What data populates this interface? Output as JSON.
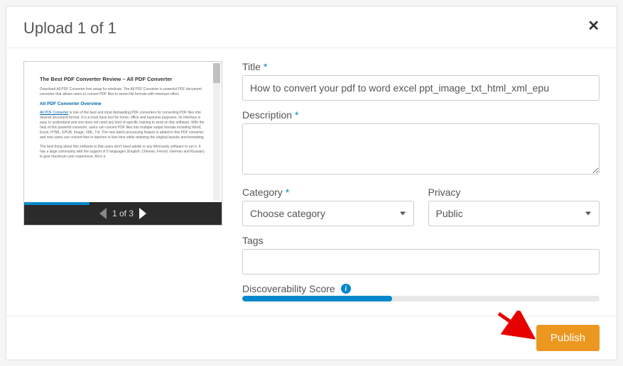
{
  "header": {
    "title": "Upload 1 of 1",
    "close_symbol": "✕"
  },
  "preview": {
    "doc_title": "The Best PDF Converter Review – All PDF Converter",
    "doc_intro": "Download All PDF Converter free setup for windows. The All PDF Converter is powerful PDF document converter that allows users to convert PDF files to seven file formats with minimum effort.",
    "doc_heading2": "All PDF Converter Overview",
    "doc_link": "All PDF Converter",
    "doc_body1": " is one of the best and most demanding PDF converters for converting PDF files into desired document format. It is a must have tool for home, office and business purposes. Its interface is easy to understand and one does not need any kind of specific training to work on this software. With the help of this powerful converter, users can convert PDF files into multiple output formats including Word, Excel, HTML, EPUB, Image, XML, Txt. The new batch processing feature is added in this PDF converter and now users can convert files in batches in less time while retaining the original layouts and formatting.",
    "doc_body2": "The best thing about this software is that users don't need adobe or any third-party software to run it. It has a large community with the support of 5 languages (English, Chinese, French, German and Russian) to give maximum user experience. All in a",
    "page_indicator": "1 of 3",
    "progress_percent": 33
  },
  "form": {
    "title_label": "Title",
    "title_value": "How to convert your pdf to word excel ppt_image_txt_html_xml_epu",
    "description_label": "Description",
    "description_value": "",
    "category_label": "Category",
    "category_value": "Choose category",
    "privacy_label": "Privacy",
    "privacy_value": "Public",
    "tags_label": "Tags",
    "tags_value": "",
    "score_label": "Discoverability Score",
    "score_percent": 42
  },
  "footer": {
    "publish_label": "Publish"
  }
}
